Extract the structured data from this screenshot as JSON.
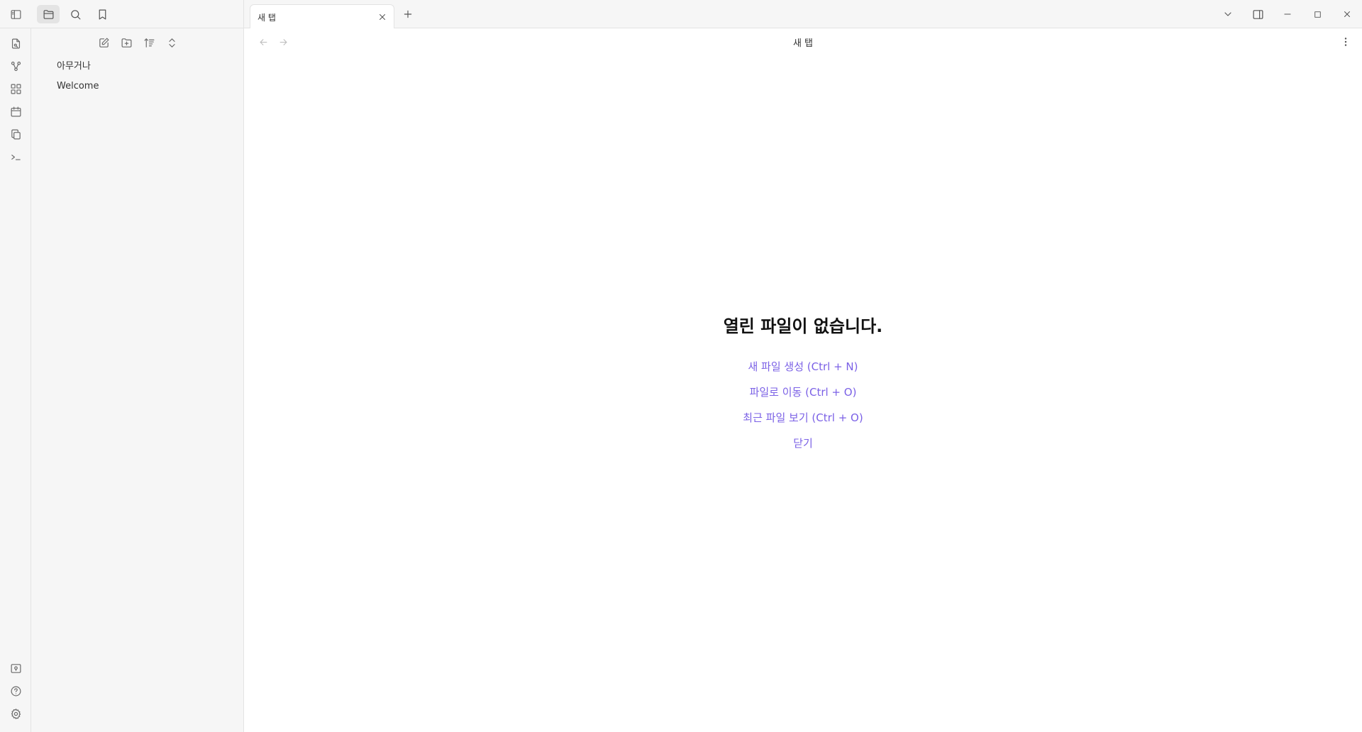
{
  "ribbon": {
    "top_items": [
      {
        "icon": "open-quick-switcher-icon"
      },
      {
        "icon": "graph-view-icon"
      },
      {
        "icon": "canvas-icon"
      },
      {
        "icon": "daily-note-calendar-icon"
      },
      {
        "icon": "templates-icon"
      },
      {
        "icon": "command-palette-icon"
      }
    ],
    "bottom_items": [
      {
        "icon": "vault-switcher-icon"
      },
      {
        "icon": "help-icon"
      },
      {
        "icon": "settings-gear-icon"
      }
    ]
  },
  "sidebar": {
    "tabs": [
      {
        "icon": "sidebar-toggle-icon"
      },
      {
        "icon": "folder-icon",
        "active": true
      },
      {
        "icon": "search-icon"
      },
      {
        "icon": "bookmark-icon"
      }
    ],
    "actions": [
      {
        "icon": "new-note-icon"
      },
      {
        "icon": "new-folder-icon"
      },
      {
        "icon": "sort-icon"
      },
      {
        "icon": "collapse-expand-icon"
      }
    ],
    "files": [
      {
        "label": "아무거나"
      },
      {
        "label": "Welcome"
      }
    ]
  },
  "tabbar": {
    "active_tab": "새 탭"
  },
  "view": {
    "title": "새 탭"
  },
  "empty_state": {
    "title": "열린 파일이 없습니다.",
    "actions": [
      "새 파일 생성 (Ctrl + N)",
      "파일로 이동 (Ctrl + O)",
      "최근 파일 보기 (Ctrl + O)",
      "닫기"
    ]
  },
  "colors": {
    "accent": "#7b61e6",
    "sidebar_bg": "#f6f6f6",
    "border": "#e3e3e3"
  }
}
